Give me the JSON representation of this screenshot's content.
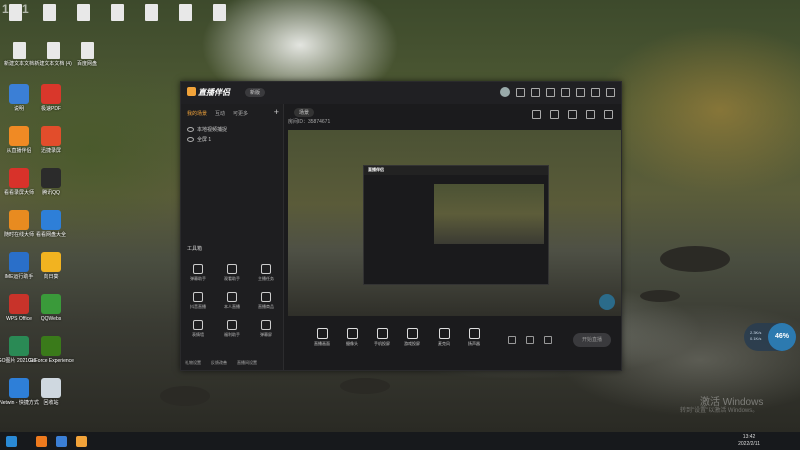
{
  "watermark": "1881",
  "desktop_icons": [
    {
      "label": "",
      "color": "#e8e8e8",
      "type": "file"
    },
    {
      "label": "",
      "color": "#e8e8e8",
      "type": "file"
    },
    {
      "label": "",
      "color": "#e8e8e8",
      "type": "file"
    },
    {
      "label": "",
      "color": "#e8e8e8",
      "type": "file"
    },
    {
      "label": "",
      "color": "#e8e8e8",
      "type": "file"
    },
    {
      "label": "",
      "color": "#e8e8e8",
      "type": "file"
    },
    {
      "label": "",
      "color": "#e8e8e8",
      "type": "file"
    },
    {
      "label": "新建文本文档",
      "color": "#e8e8e8",
      "type": "file"
    },
    {
      "label": "新建文本文档 (4)",
      "color": "#e8e8e8",
      "type": "file"
    },
    {
      "label": "百度网盘",
      "color": "#e8e8e8",
      "type": "file"
    },
    {
      "label": "说明",
      "color": "#3b7fd6",
      "type": "app"
    },
    {
      "label": "极速PDF",
      "color": "#d9372b",
      "type": "app"
    },
    {
      "label": "从直播伴侣",
      "color": "#f08a24",
      "type": "app"
    },
    {
      "label": "迅捷录屏",
      "color": "#e24d2b",
      "type": "app"
    },
    {
      "label": "看看录屏大师",
      "color": "#d8322a",
      "type": "app"
    },
    {
      "label": "腾讯QQ",
      "color": "#2b2b2b",
      "type": "app"
    },
    {
      "label": "随时在线大师",
      "color": "#e88b20",
      "type": "app"
    },
    {
      "label": "看看网盘大全",
      "color": "#2e7fd8",
      "type": "app"
    },
    {
      "label": "IME运行助手",
      "color": "#2a6fc9",
      "type": "app"
    },
    {
      "label": "向日葵",
      "color": "#f2b320",
      "type": "app"
    },
    {
      "label": "WPS Office",
      "color": "#c8332a",
      "type": "app"
    },
    {
      "label": "QQWebs",
      "color": "#3a9a3a",
      "type": "app"
    },
    {
      "label": "GO图片 2021011...",
      "color": "#2a8a55",
      "type": "app"
    },
    {
      "label": "GeForce Experience",
      "color": "#3a7a1a",
      "type": "app"
    },
    {
      "label": "Netwin - 快捷方式",
      "color": "#2e7fd8",
      "type": "app"
    },
    {
      "label": "回收站",
      "color": "#cfd8e0",
      "type": "app"
    }
  ],
  "app": {
    "title": "直播伴侣",
    "version_badge": "新版",
    "tabs": [
      "我的场景",
      "互动",
      "可更多"
    ],
    "scenes": [
      "本地视频捕捉",
      "全屏 1"
    ],
    "tools_title": "工具箱",
    "tools": [
      "弹幕助手",
      "观看助手",
      "主播任务",
      "抖音直播",
      "本人直播",
      "直播商品",
      "表情墙",
      "福利助手",
      "弹幕屏"
    ],
    "footer_items": [
      "礼物设置",
      "反馈改善",
      "直播间设置"
    ],
    "scene_button": "场景",
    "room_info": "房间ID：35874671",
    "toolbar": [
      "直播画面",
      "摄像头",
      "手机投屏",
      "游戏投屏",
      "麦克风",
      "扬声器"
    ],
    "start_live": "开始直播"
  },
  "taskbar": {
    "time": "13:42",
    "date": "2022/2/11"
  },
  "windows_watermark": "激活 Windows",
  "windows_watermark_sub": "转到\"设置\"以激活 Windows。",
  "net_widget": {
    "percent": "46%",
    "up": "2.3K/s",
    "down": "0.1K/s"
  }
}
